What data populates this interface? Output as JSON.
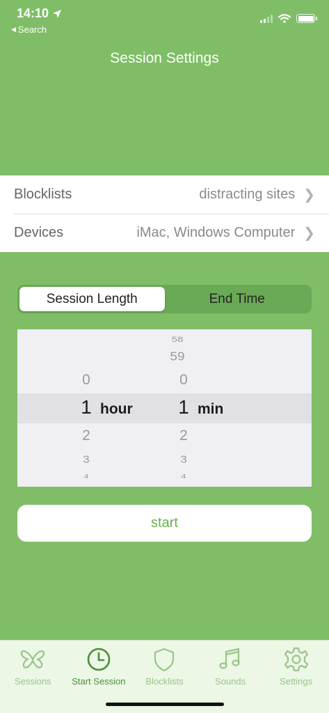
{
  "status_bar": {
    "time": "14:10",
    "back_label": "Search"
  },
  "nav": {
    "title": "Session Settings"
  },
  "settings": {
    "rows": [
      {
        "label": "Blocklists",
        "value": "distracting sites"
      },
      {
        "label": "Devices",
        "value": "iMac, Windows Computer"
      }
    ]
  },
  "segmented": {
    "options": [
      "Session Length",
      "End Time"
    ],
    "selected": "Session Length"
  },
  "picker": {
    "hours": {
      "above": [
        "0"
      ],
      "selected": "1",
      "below": [
        "2",
        "3",
        "4"
      ],
      "unit": "hour"
    },
    "minutes": {
      "above": [
        "58",
        "59",
        "0"
      ],
      "selected": "1",
      "below": [
        "2",
        "3",
        "4"
      ],
      "unit": "min"
    }
  },
  "start_button": {
    "label": "start"
  },
  "tab_bar": {
    "tabs": [
      {
        "label": "Sessions",
        "icon": "butterfly-icon"
      },
      {
        "label": "Start Session",
        "icon": "clock-icon",
        "active": true
      },
      {
        "label": "Blocklists",
        "icon": "shield-icon"
      },
      {
        "label": "Sounds",
        "icon": "music-note-icon"
      },
      {
        "label": "Settings",
        "icon": "gear-icon"
      }
    ]
  },
  "colors": {
    "background": "#7fbe67",
    "accent": "#6ab04c",
    "tab_active": "#4f8d37",
    "tab_inactive": "#9bc48a"
  }
}
